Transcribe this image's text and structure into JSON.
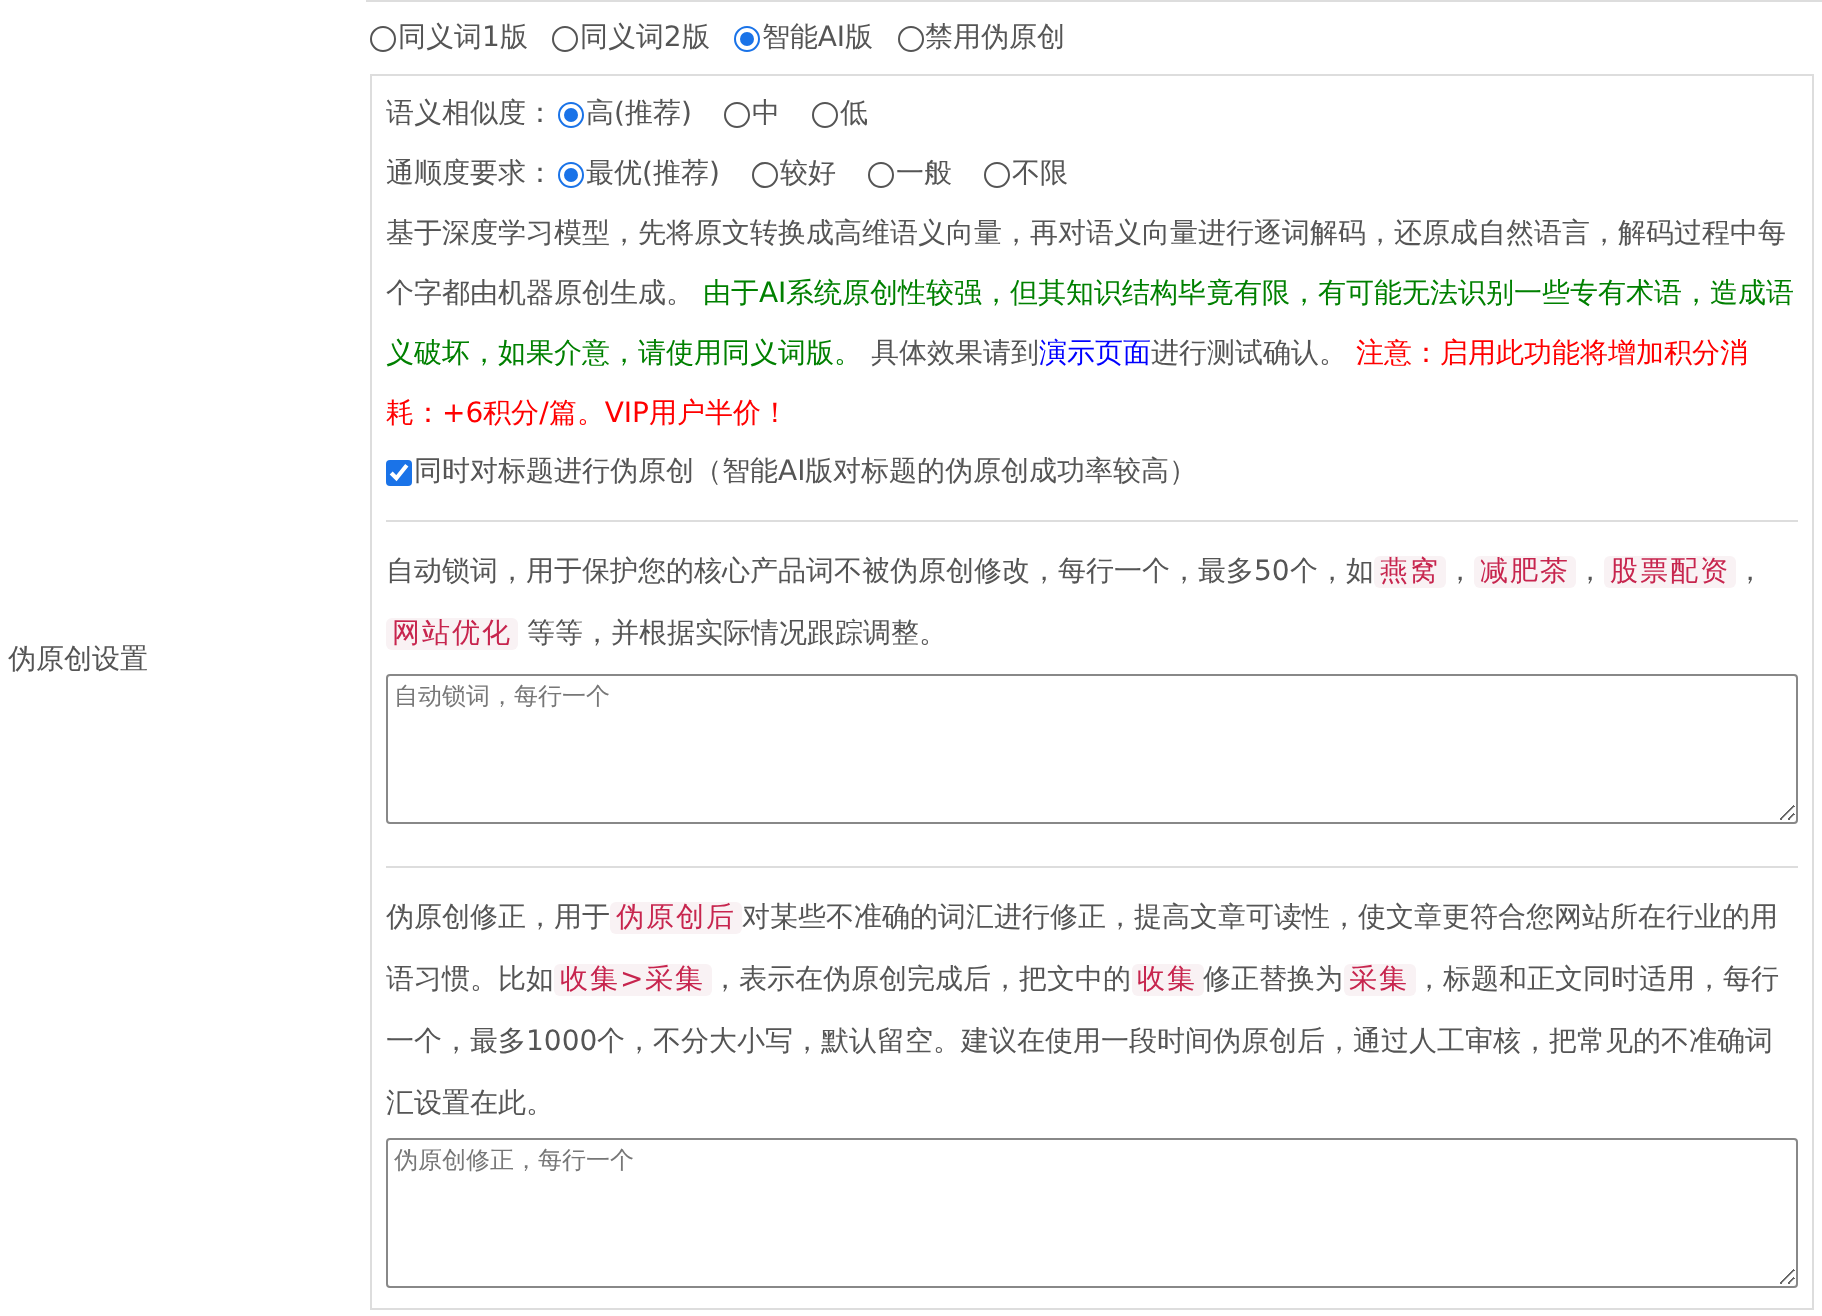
{
  "side_label": "伪原创设置",
  "modes": [
    {
      "label": "同义词1版",
      "selected": false
    },
    {
      "label": "同义词2版",
      "selected": false
    },
    {
      "label": "智能AI版",
      "selected": true
    },
    {
      "label": "禁用伪原创",
      "selected": false
    }
  ],
  "similarity": {
    "label": "语义相似度：",
    "options": [
      {
        "label": "高(推荐)",
        "selected": true
      },
      {
        "label": "中",
        "selected": false
      },
      {
        "label": "低",
        "selected": false
      }
    ]
  },
  "fluency": {
    "label": "通顺度要求：",
    "options": [
      {
        "label": "最优(推荐)",
        "selected": true
      },
      {
        "label": "较好",
        "selected": false
      },
      {
        "label": "一般",
        "selected": false
      },
      {
        "label": "不限",
        "selected": false
      }
    ]
  },
  "description": [
    {
      "kind": "text",
      "text": "基于深度学习模型，先将原文转换成高维语义向量，再对语义向量进行逐词解码，还原成自然语言，解码过程中每个字都由机器原创生成。 "
    },
    {
      "kind": "note",
      "text": "由于AI系统原创性较强，但其知识结构毕竟有限，有可能无法识别一些专有术语，造成语义破坏，如果介意，请使用同义词版。"
    },
    {
      "kind": "text",
      "text": " 具体效果请到"
    },
    {
      "kind": "link",
      "text": "演示页面"
    },
    {
      "kind": "text",
      "text": "进行测试确认。 "
    },
    {
      "kind": "warning",
      "text": "注意：启用此功能将增加积分消耗：+6积分/篇。VIP用户半价！"
    }
  ],
  "title_option": {
    "label": "同时对标题进行伪原创（智能AI版对标题的伪原创成功率较高）",
    "checked": true
  },
  "lock_words": {
    "description": [
      {
        "kind": "text",
        "text": "自动锁词，用于保护您的核心产品词不被伪原创修改，每行一个，最多50个，如"
      },
      {
        "kind": "tag",
        "text": "燕窝"
      },
      {
        "kind": "text",
        "text": "，"
      },
      {
        "kind": "tag",
        "text": "减肥茶"
      },
      {
        "kind": "text",
        "text": "，"
      },
      {
        "kind": "tag",
        "text": "股票配资"
      },
      {
        "kind": "text",
        "text": "，"
      },
      {
        "kind": "tag",
        "text": "网站优化"
      },
      {
        "kind": "text",
        "text": " 等等，并根据实际情况跟踪调整。"
      }
    ],
    "placeholder": "自动锁词，每行一个"
  },
  "corrections": {
    "description": [
      {
        "kind": "text",
        "text": "伪原创修正，用于"
      },
      {
        "kind": "tag",
        "text": "伪原创后"
      },
      {
        "kind": "text",
        "text": "对某些不准确的词汇进行修正，提高文章可读性，使文章更符合您网站所在行业的用语习惯。比如"
      },
      {
        "kind": "tag",
        "text": "收集>采集"
      },
      {
        "kind": "text",
        "text": "，表示在伪原创完成后，把文中的"
      },
      {
        "kind": "tag",
        "text": "收集"
      },
      {
        "kind": "text",
        "text": "修正替换为"
      },
      {
        "kind": "tag",
        "text": "采集"
      },
      {
        "kind": "text",
        "text": "，标题和正文同时适用，每行一个，最多1000个，不分大小写，默认留空。建议在使用一段时间伪原创后，通过人工审核，把常见的不准确词汇设置在此。"
      }
    ],
    "placeholder": "伪原创修正，每行一个"
  }
}
